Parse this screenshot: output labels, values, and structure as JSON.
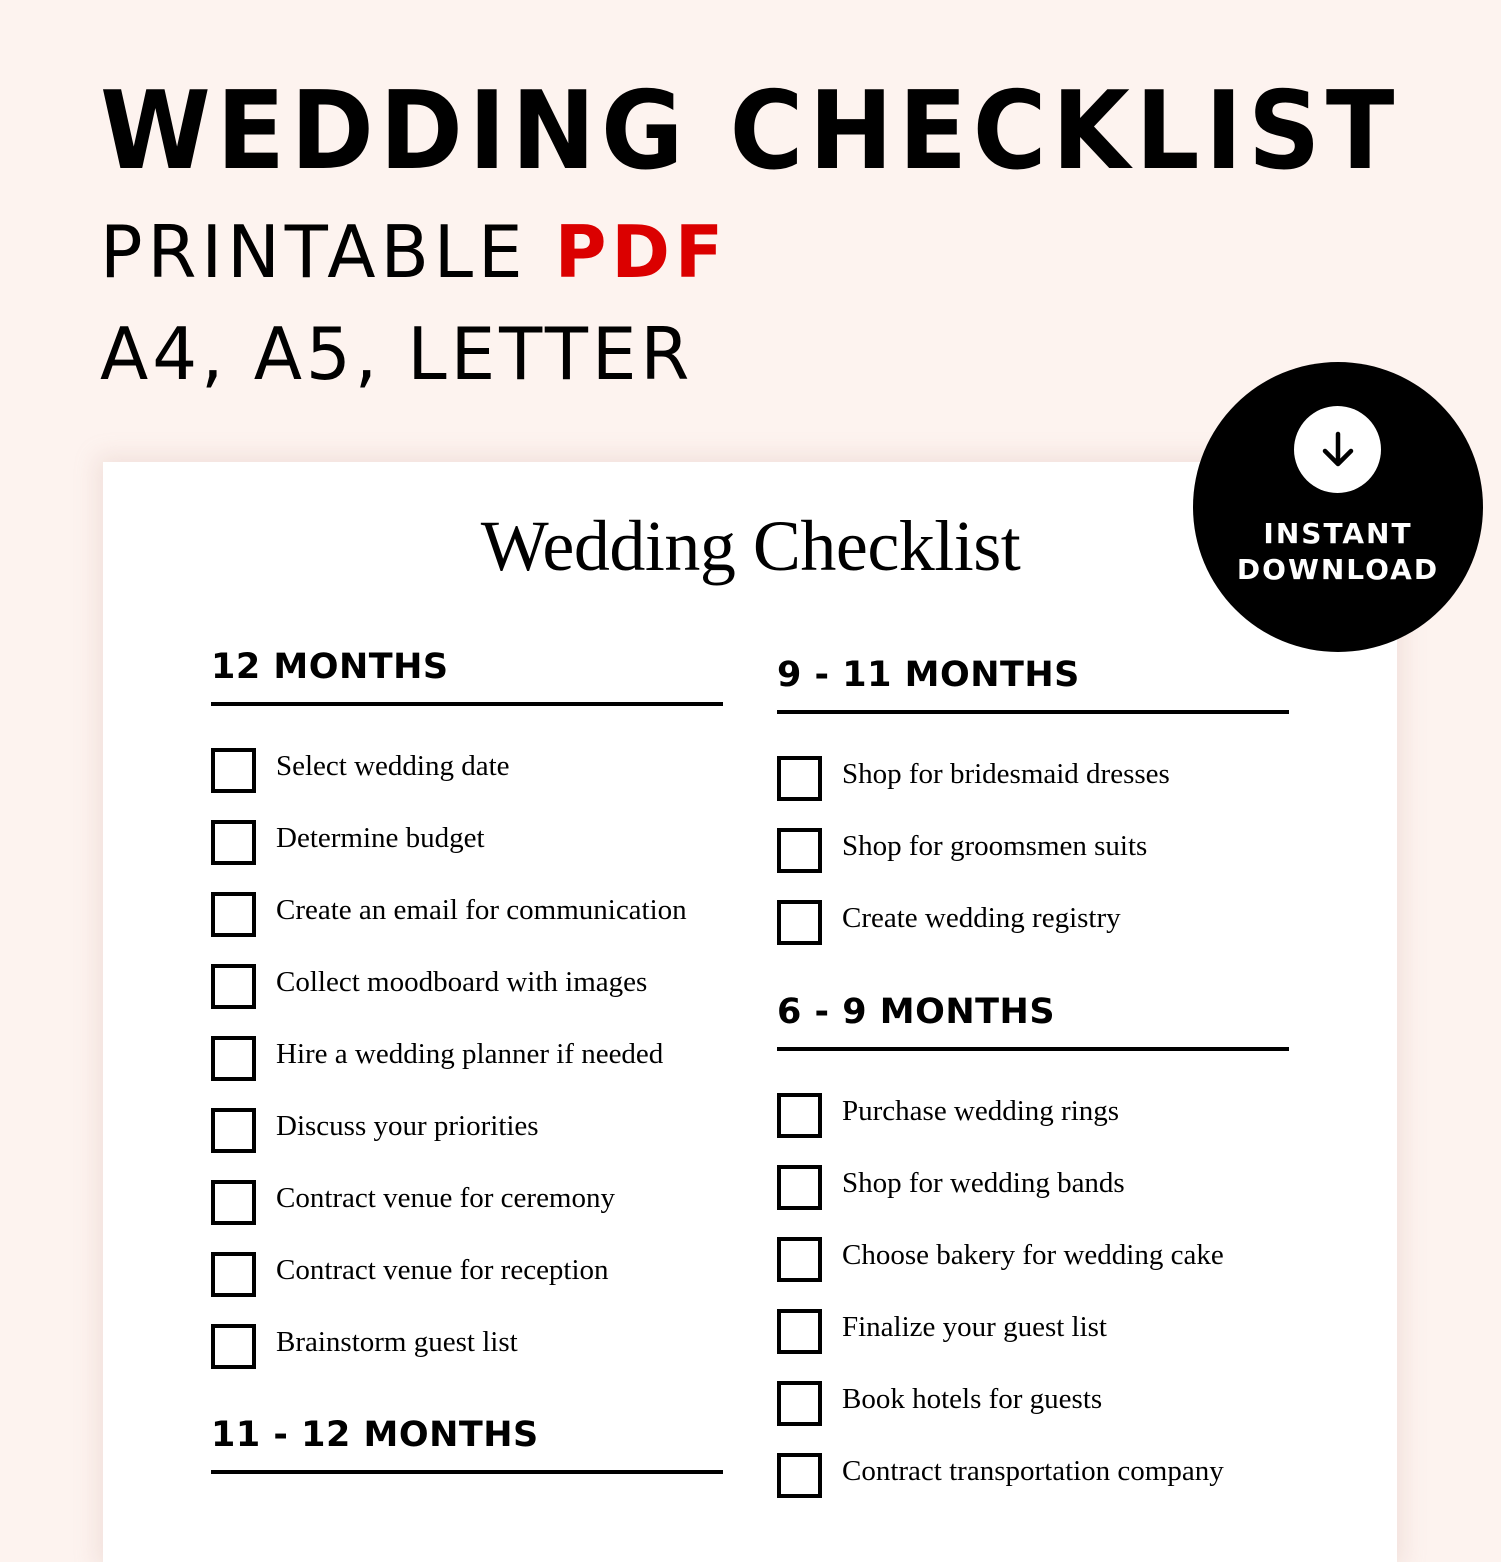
{
  "hero": {
    "title": "WEDDING CHECKLIST",
    "subtitle_prefix": "PRINTABLE",
    "subtitle_accent": "PDF",
    "formats": "A4, A5, LETTER"
  },
  "badge": {
    "icon": "download-arrow-icon",
    "line1": "INSTANT",
    "line2": "DOWNLOAD"
  },
  "document": {
    "title": "Wedding Checklist",
    "sections": [
      {
        "heading": "12 MONTHS",
        "items": [
          "Select wedding date",
          "Determine budget",
          "Create an email for communication",
          "Collect moodboard with images",
          "Hire a wedding planner if needed",
          "Discuss your priorities",
          "Contract venue for ceremony",
          "Contract venue for reception",
          "Brainstorm guest list"
        ]
      },
      {
        "heading": "11 - 12 MONTHS",
        "items": []
      },
      {
        "heading": "9 - 11 MONTHS",
        "items": [
          "Shop for bridesmaid dresses",
          "Shop for groomsmen suits",
          "Create wedding registry"
        ]
      },
      {
        "heading": "6 - 9 MONTHS",
        "items": [
          "Purchase wedding rings",
          "Shop for wedding bands",
          "Choose bakery for wedding cake",
          "Finalize your guest list",
          "Book hotels for guests",
          "Contract transportation company"
        ]
      }
    ]
  },
  "colors": {
    "background": "#fdf3ef",
    "accent": "#db0000",
    "text": "#000000",
    "paper": "#ffffff"
  }
}
